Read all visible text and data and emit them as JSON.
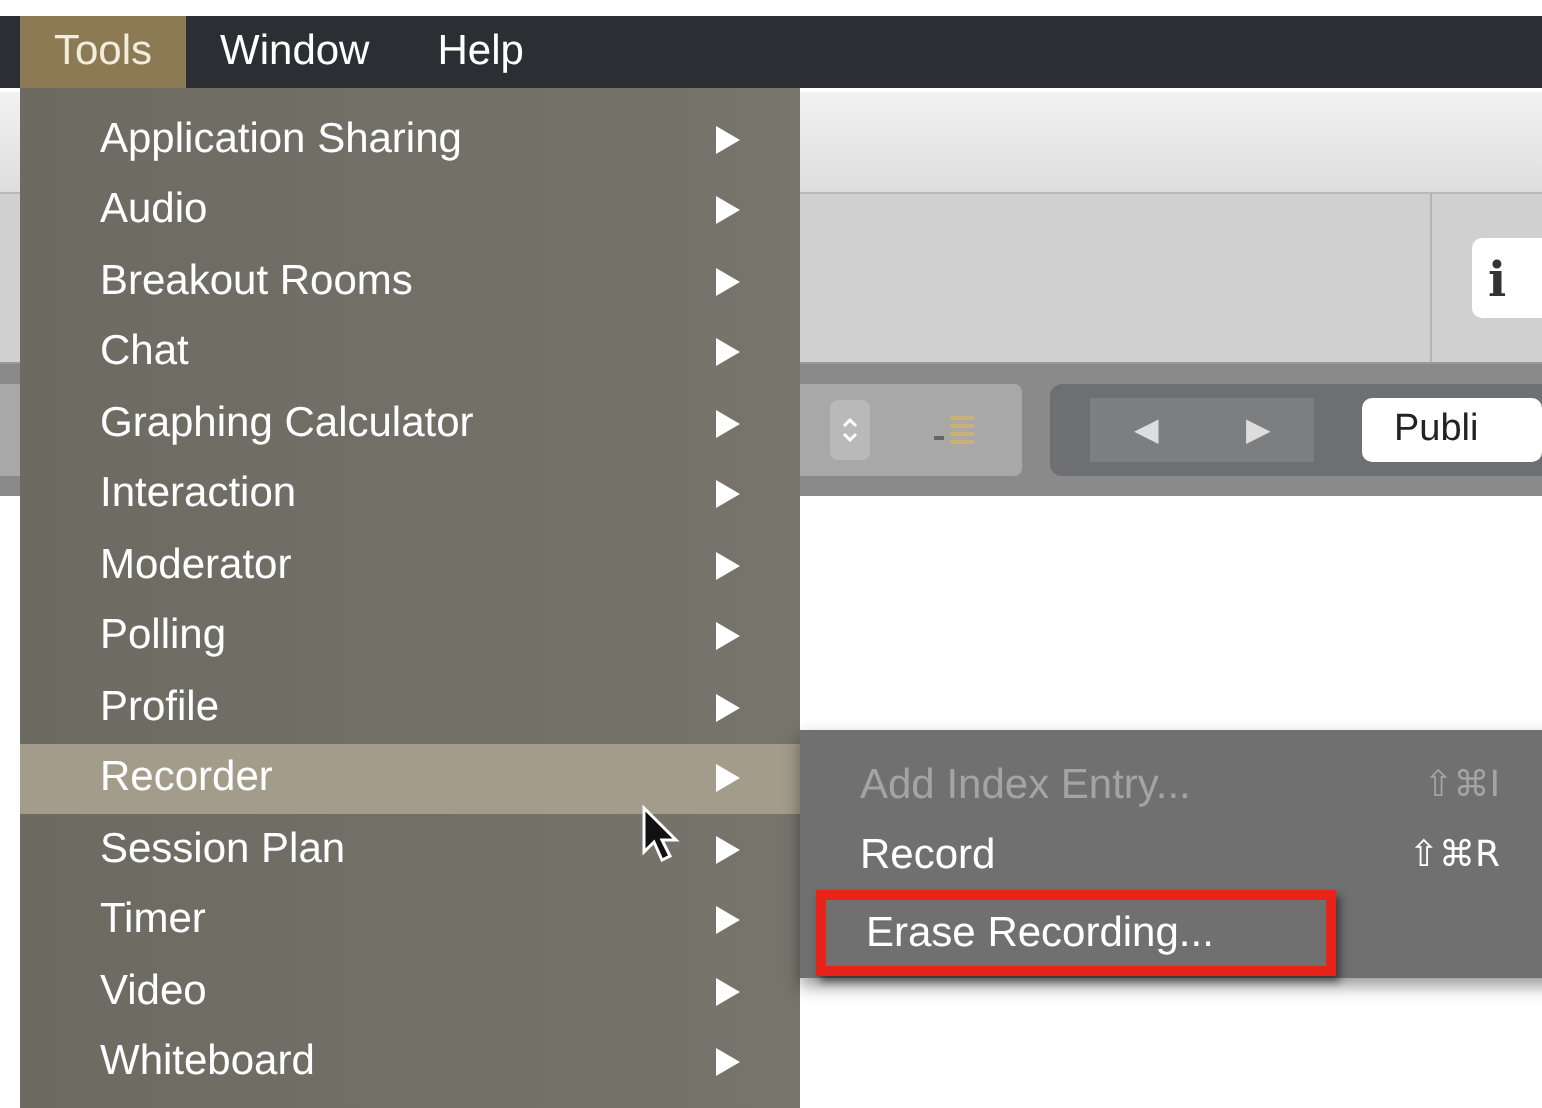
{
  "menubar": [
    {
      "label": "Tools",
      "selected": true
    },
    {
      "label": "Window",
      "selected": false
    },
    {
      "label": "Help",
      "selected": false
    }
  ],
  "background_window": {
    "info_button": "i",
    "pager": {
      "prev": "◀",
      "next": "▶"
    },
    "filter_button": "Publi"
  },
  "menu": {
    "items": [
      {
        "label": "Application Sharing",
        "submenu": true,
        "selected": false
      },
      {
        "label": "Audio",
        "submenu": true,
        "selected": false
      },
      {
        "label": "Breakout Rooms",
        "submenu": true,
        "selected": false
      },
      {
        "label": "Chat",
        "submenu": true,
        "selected": false
      },
      {
        "label": "Graphing Calculator",
        "submenu": true,
        "selected": false
      },
      {
        "label": "Interaction",
        "submenu": true,
        "selected": false
      },
      {
        "label": "Moderator",
        "submenu": true,
        "selected": false
      },
      {
        "label": "Polling",
        "submenu": true,
        "selected": false
      },
      {
        "label": "Profile",
        "submenu": true,
        "selected": false
      },
      {
        "label": "Recorder",
        "submenu": true,
        "selected": true
      },
      {
        "label": "Session Plan",
        "submenu": true,
        "selected": false
      },
      {
        "label": "Timer",
        "submenu": true,
        "selected": false
      },
      {
        "label": "Video",
        "submenu": true,
        "selected": false
      },
      {
        "label": "Whiteboard",
        "submenu": true,
        "selected": false
      }
    ]
  },
  "submenu": {
    "items": [
      {
        "label": "Add Index Entry...",
        "shortcut": "⇧⌘I",
        "disabled": true,
        "highlighted": false
      },
      {
        "label": "Record",
        "shortcut": "⇧⌘R",
        "disabled": false,
        "highlighted": false
      },
      {
        "label": "Erase Recording...",
        "disabled": false,
        "highlighted": true
      }
    ]
  }
}
